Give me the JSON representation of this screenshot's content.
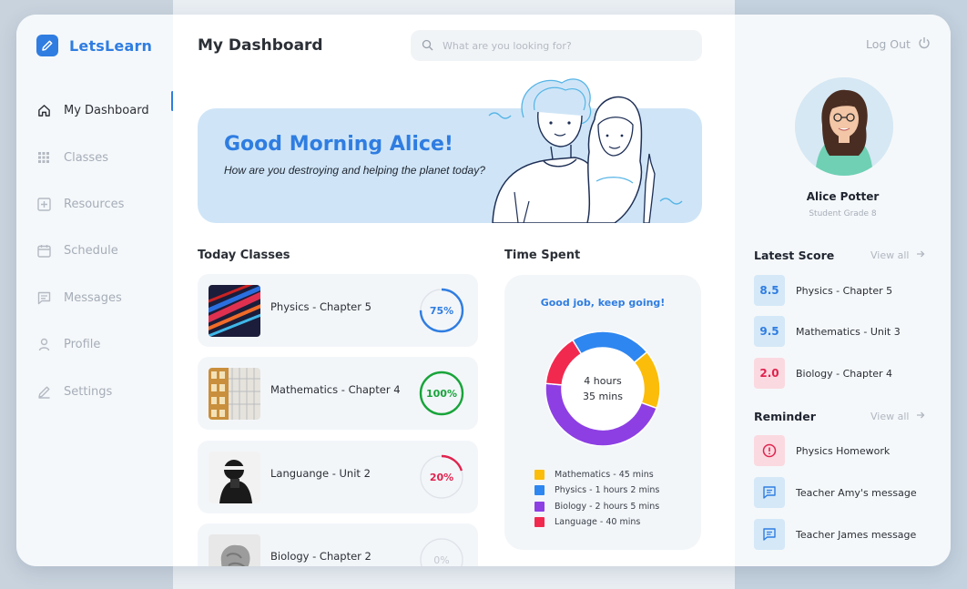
{
  "app": {
    "name": "LetsLearn"
  },
  "sidebar": {
    "items": [
      {
        "label": "My Dashboard",
        "icon": "home-icon",
        "active": true
      },
      {
        "label": "Classes",
        "icon": "grid-icon"
      },
      {
        "label": "Resources",
        "icon": "plus-square-icon"
      },
      {
        "label": "Schedule",
        "icon": "calendar-icon"
      },
      {
        "label": "Messages",
        "icon": "message-icon"
      },
      {
        "label": "Profile",
        "icon": "user-icon"
      },
      {
        "label": "Settings",
        "icon": "pencil-icon"
      }
    ]
  },
  "header": {
    "title": "My Dashboard",
    "search_placeholder": "What are you looking for?"
  },
  "banner": {
    "greeting": "Good Morning Alice!",
    "subtitle": "How are you destroying and helping the planet today?"
  },
  "today_classes": {
    "title": "Today Classes",
    "items": [
      {
        "name": "Physics - Chapter 5",
        "progress_label": "75%",
        "progress": 75,
        "color": "#2f7de1"
      },
      {
        "name": "Mathematics - Chapter 4",
        "progress_label": "100%",
        "progress": 100,
        "color": "#18a43a"
      },
      {
        "name": "Languange - Unit 2",
        "progress_label": "20%",
        "progress": 20,
        "color": "#e0234e"
      },
      {
        "name": "Biology - Chapter 2",
        "progress_label": "0%",
        "progress": 0,
        "color": "#c3c9d1"
      }
    ]
  },
  "time_spent": {
    "title": "Time Spent",
    "message": "Good job, keep going!",
    "total_line1": "4 hours",
    "total_line2": "35 mins",
    "legend": [
      {
        "label": "Mathematics - 45 mins",
        "color": "#fbbd0a"
      },
      {
        "label": "Physics - 1 hours 2 mins",
        "color": "#2e86f0"
      },
      {
        "label": "Biology - 2 hours 5 mins",
        "color": "#8d3fe3"
      },
      {
        "label": "Language - 40 mins",
        "color": "#f2294f"
      }
    ]
  },
  "chart_data": {
    "type": "pie",
    "categories": [
      "Mathematics",
      "Physics",
      "Biology",
      "Language"
    ],
    "values": [
      45,
      62,
      125,
      40
    ],
    "colors": [
      "#fbbd0a",
      "#2e86f0",
      "#8d3fe3",
      "#f2294f"
    ]
  },
  "profile": {
    "logout_label": "Log Out",
    "name": "Alice Potter",
    "grade": "Student Grade 8"
  },
  "latest_score": {
    "title": "Latest Score",
    "view_all": "View all",
    "items": [
      {
        "score": "8.5",
        "label": "Physics - Chapter 5",
        "bg": "#d4e8f8",
        "fg": "#2f7de1"
      },
      {
        "score": "9.5",
        "label": "Mathematics - Unit 3",
        "bg": "#d4e8f8",
        "fg": "#2f7de1"
      },
      {
        "score": "2.0",
        "label": "Biology - Chapter 4",
        "bg": "#fbd9e0",
        "fg": "#e0234e"
      }
    ]
  },
  "reminder": {
    "title": "Reminder",
    "view_all": "View all",
    "items": [
      {
        "label": "Physics Homework",
        "icon": "alert-icon"
      },
      {
        "label": "Teacher Amy's message",
        "icon": "chat-icon"
      },
      {
        "label": "Teacher James message",
        "icon": "chat-icon"
      }
    ]
  }
}
